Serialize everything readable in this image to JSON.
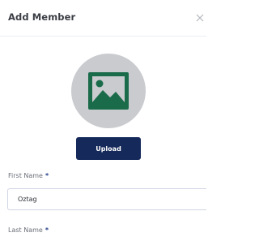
{
  "modal": {
    "title": "Add Member",
    "close_icon": "close-icon"
  },
  "avatar": {
    "icon": "image-placeholder-icon",
    "background_color": "#c9cbcf",
    "icon_color": "#1a6b4a"
  },
  "upload": {
    "label": "Upload",
    "color": "#15295a"
  },
  "form": {
    "first_name": {
      "label": "First Name",
      "required_mark": "*",
      "value": "Oztag"
    },
    "last_name": {
      "label": "Last Name",
      "required_mark": "*",
      "value": ""
    }
  }
}
